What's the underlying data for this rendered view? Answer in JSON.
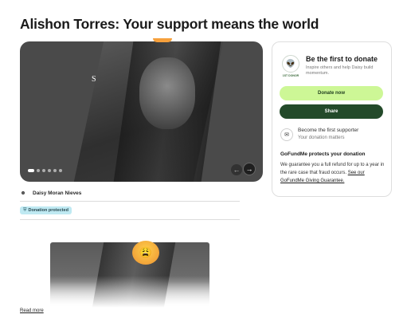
{
  "page": {
    "title": "Alishon Torres: Your support means the world"
  },
  "hero": {
    "overlay_text": "S",
    "dots_total": 6,
    "active_dot": 0,
    "prev_icon": "arrow-left-icon",
    "next_icon": "arrow-right-icon"
  },
  "organizer": {
    "name": "Daisy Moran Nieves",
    "icon": "organizer-icon"
  },
  "protected_badge": {
    "label": "Donation protected",
    "icon": "shield-icon"
  },
  "story": {
    "read_more": "Read more",
    "emoji": "😩"
  },
  "donate_card": {
    "badge_label": "1ST DONOR",
    "badge_icon": "alien-donor-icon",
    "heading": "Be the first to donate",
    "subtext": "Inspire others and help Daisy build momentum.",
    "donate_label": "Donate now",
    "share_label": "Share",
    "supporter_icon": "supporter-icon",
    "supporter_title": "Become the first supporter",
    "supporter_sub": "Your donation matters",
    "protect_heading": "GoFundMe protects your donation",
    "protect_body": "We guarantee you a full refund for up to a year in the rare case that fraud occurs.",
    "protect_link": "See our GoFundMe Giving Guarantee."
  },
  "colors": {
    "donate_bg": "#cdf796",
    "share_bg": "#234a2a",
    "badge_bg": "#bfe9f2"
  }
}
